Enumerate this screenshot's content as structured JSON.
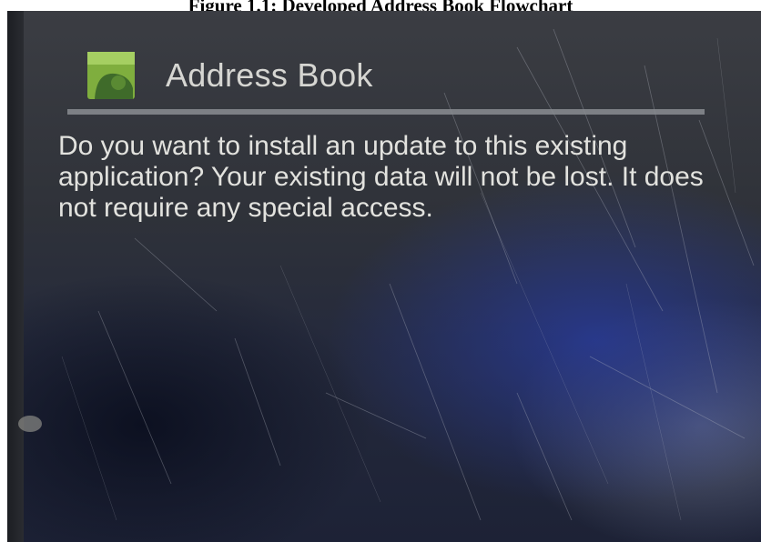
{
  "caption": "Figure 1.1: Developed Address Book Flowchart",
  "dialog": {
    "app_icon": "android-app-icon",
    "title": "Address Book",
    "message": "Do you want to install an update to this existing application? Your existing data will not be lost. It does not require any special access."
  },
  "colors": {
    "screen_dark": "#2f3239",
    "screen_blue": "#283a96",
    "icon_green": "#7fae3e",
    "text": "#e2e2de"
  }
}
